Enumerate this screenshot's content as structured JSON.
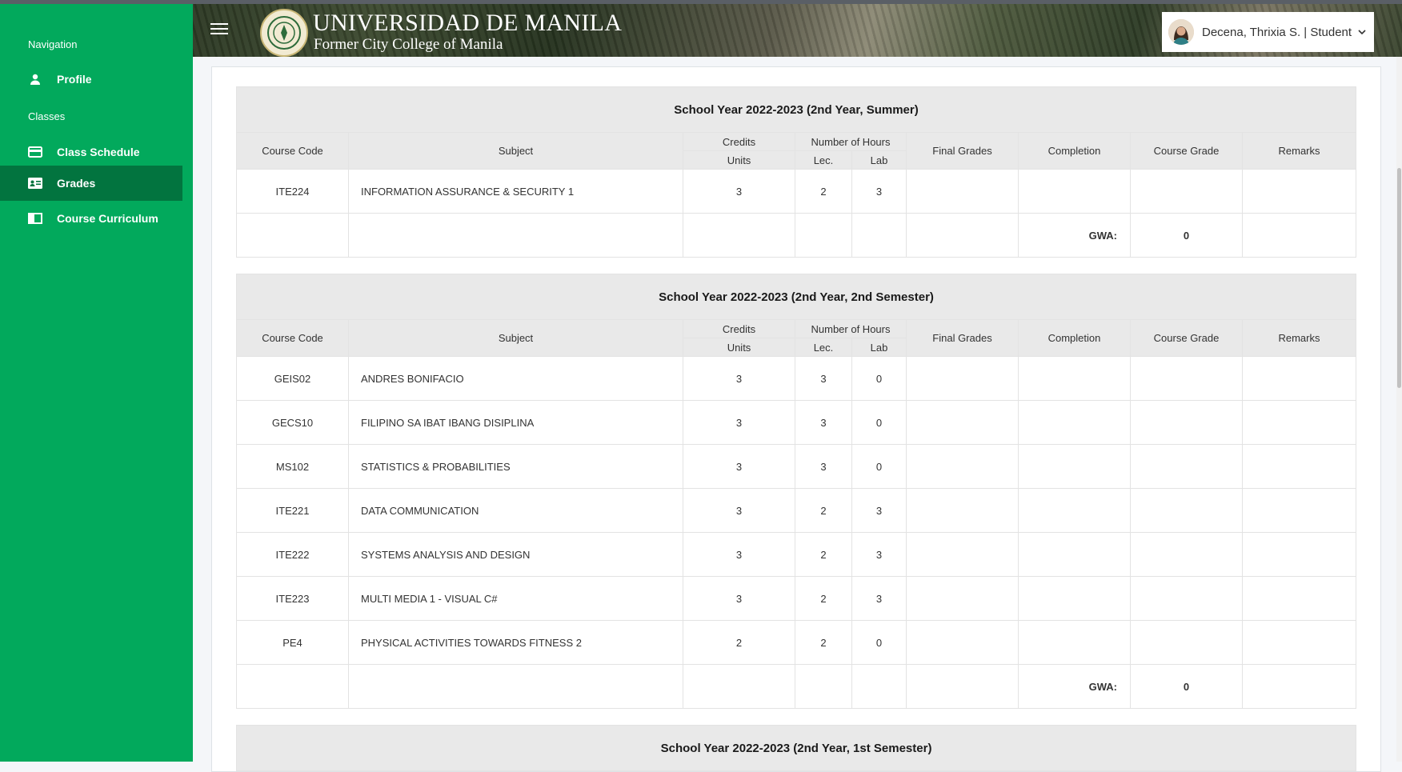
{
  "sidebar": {
    "sections": [
      {
        "heading": "Navigation",
        "items": [
          {
            "label": "Profile",
            "icon": "user-icon"
          }
        ]
      },
      {
        "heading": "Classes",
        "items": [
          {
            "label": "Class Schedule",
            "icon": "card-icon"
          },
          {
            "label": "Grades",
            "icon": "id-card-icon",
            "active": true
          },
          {
            "label": "Course Curriculum",
            "icon": "book-icon"
          }
        ]
      }
    ],
    "color": "#02a95c",
    "active_color": "#02743f"
  },
  "header": {
    "university": "UNIVERSIDAD DE MANILA",
    "subtitle": "Former City College of Manila",
    "user": "Decena, Thrixia S. | Student"
  },
  "table_headers": {
    "course_code": "Course Code",
    "subject": "Subject",
    "credits": "Credits",
    "units": "Units",
    "hours": "Number of Hours",
    "lec": "Lec.",
    "lab": "Lab",
    "final_grades": "Final Grades",
    "completion": "Completion",
    "course_grade": "Course Grade",
    "remarks": "Remarks"
  },
  "terms": [
    {
      "title": "School Year 2022-2023 (2nd Year, Summer)",
      "courses": [
        {
          "code": "ITE224",
          "subject": "INFORMATION ASSURANCE & SECURITY 1",
          "units": "3",
          "lec": "2",
          "lab": "3",
          "final": "",
          "completion": "",
          "course_grade": "",
          "remarks": ""
        }
      ],
      "gwa_label": "GWA:",
      "gwa": "0"
    },
    {
      "title": "School Year 2022-2023 (2nd Year, 2nd Semester)",
      "courses": [
        {
          "code": "GEIS02",
          "subject": "ANDRES BONIFACIO",
          "units": "3",
          "lec": "3",
          "lab": "0",
          "final": "",
          "completion": "",
          "course_grade": "",
          "remarks": ""
        },
        {
          "code": "GECS10",
          "subject": "FILIPINO SA IBAT IBANG DISIPLINA",
          "units": "3",
          "lec": "3",
          "lab": "0",
          "final": "",
          "completion": "",
          "course_grade": "",
          "remarks": ""
        },
        {
          "code": "MS102",
          "subject": "STATISTICS & PROBABILITIES",
          "units": "3",
          "lec": "3",
          "lab": "0",
          "final": "",
          "completion": "",
          "course_grade": "",
          "remarks": ""
        },
        {
          "code": "ITE221",
          "subject": "DATA COMMUNICATION",
          "units": "3",
          "lec": "2",
          "lab": "3",
          "final": "",
          "completion": "",
          "course_grade": "",
          "remarks": ""
        },
        {
          "code": "ITE222",
          "subject": "SYSTEMS ANALYSIS AND DESIGN",
          "units": "3",
          "lec": "2",
          "lab": "3",
          "final": "",
          "completion": "",
          "course_grade": "",
          "remarks": ""
        },
        {
          "code": "ITE223",
          "subject": "MULTI MEDIA 1 - VISUAL C#",
          "units": "3",
          "lec": "2",
          "lab": "3",
          "final": "",
          "completion": "",
          "course_grade": "",
          "remarks": ""
        },
        {
          "code": "PE4",
          "subject": "PHYSICAL ACTIVITIES TOWARDS FITNESS 2",
          "units": "2",
          "lec": "2",
          "lab": "0",
          "final": "",
          "completion": "",
          "course_grade": "",
          "remarks": ""
        }
      ],
      "gwa_label": "GWA:",
      "gwa": "0"
    },
    {
      "title": "School Year 2022-2023 (2nd Year, 1st Semester)",
      "courses": []
    }
  ]
}
